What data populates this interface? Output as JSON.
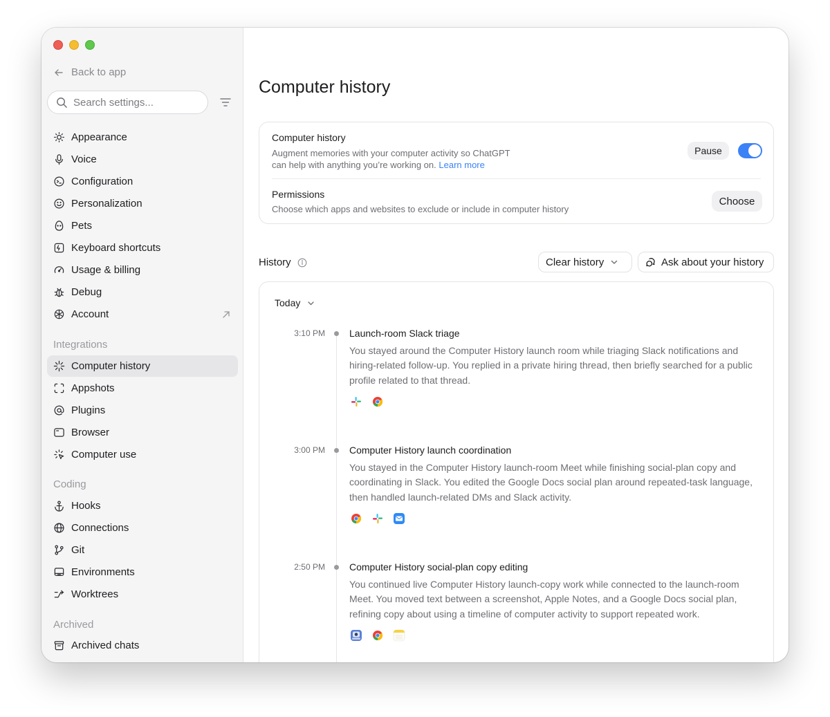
{
  "sidebar": {
    "back_label": "Back to app",
    "search_placeholder": "Search settings...",
    "items": [
      {
        "label": "Appearance",
        "icon": "sun-icon"
      },
      {
        "label": "Voice",
        "icon": "microphone-icon"
      },
      {
        "label": "Configuration",
        "icon": "config-icon"
      },
      {
        "label": "Personalization",
        "icon": "smiley-icon"
      },
      {
        "label": "Pets",
        "icon": "egg-icon"
      },
      {
        "label": "Keyboard shortcuts",
        "icon": "keyboard-icon"
      },
      {
        "label": "Usage & billing",
        "icon": "gauge-icon"
      },
      {
        "label": "Debug",
        "icon": "bug-icon"
      },
      {
        "label": "Account",
        "icon": "openai-icon"
      }
    ],
    "integrations_label": "Integrations",
    "integrations": [
      {
        "label": "Computer history",
        "icon": "sparkle-burst-icon",
        "active": true
      },
      {
        "label": "Appshots",
        "icon": "screenshot-frame-icon"
      },
      {
        "label": "Plugins",
        "icon": "at-icon"
      },
      {
        "label": "Browser",
        "icon": "browser-window-icon"
      },
      {
        "label": "Computer use",
        "icon": "cursor-sparkle-icon"
      }
    ],
    "coding_label": "Coding",
    "coding": [
      {
        "label": "Hooks",
        "icon": "anchor-icon"
      },
      {
        "label": "Connections",
        "icon": "globe-icon"
      },
      {
        "label": "Git",
        "icon": "git-branch-icon"
      },
      {
        "label": "Environments",
        "icon": "laptop-icon"
      },
      {
        "label": "Worktrees",
        "icon": "worktree-icon"
      }
    ],
    "archived_label": "Archived",
    "archived": [
      {
        "label": "Archived chats",
        "icon": "archive-box-icon"
      }
    ]
  },
  "main": {
    "title": "Computer history",
    "settings_card": {
      "history_title": "Computer history",
      "history_desc_line1": "Augment memories with your computer activity so ChatGPT",
      "history_desc_line2": "can help with anything you’re working on.",
      "learn_more": "Learn more",
      "pause_label": "Pause",
      "toggle_on": true,
      "permissions_title": "Permissions",
      "permissions_desc": "Choose which apps and websites to exclude or include in computer history",
      "choose_label": "Choose"
    },
    "history_label": "History",
    "clear_history_label": "Clear history",
    "ask_label": "Ask about your history",
    "day_label": "Today",
    "entries": [
      {
        "time": "3:10 PM",
        "title": "Launch-room Slack triage",
        "desc": "You stayed around the Computer History launch room while triaging Slack notifications and hiring-related follow-up. You replied in a private hiring thread, then briefly searched for a public profile related to that thread.",
        "apps": [
          "slack-icon",
          "chrome-icon"
        ]
      },
      {
        "time": "3:00 PM",
        "title": "Computer History launch coordination",
        "desc": "You stayed in the Computer History launch-room Meet while finishing social-plan copy and coordinating in Slack. You edited the Google Docs social plan around repeated-task language, then handled launch-related DMs and Slack activity.",
        "apps": [
          "chrome-icon",
          "slack-icon",
          "mail-icon"
        ]
      },
      {
        "time": "2:50 PM",
        "title": "Computer History social-plan copy editing",
        "desc": "You continued live Computer History launch-copy work while connected to the launch-room Meet. You moved text between a screenshot, Apple Notes, and a Google Docs social plan, refining copy about using a timeline of computer activity to support repeated work.",
        "apps": [
          "screenshot-app-icon",
          "chrome-icon",
          "notes-icon"
        ]
      }
    ]
  },
  "colors": {
    "accent": "#3b82f6",
    "sidebar_bg": "#f5f5f6",
    "active_item_bg": "#e6e6e9"
  }
}
